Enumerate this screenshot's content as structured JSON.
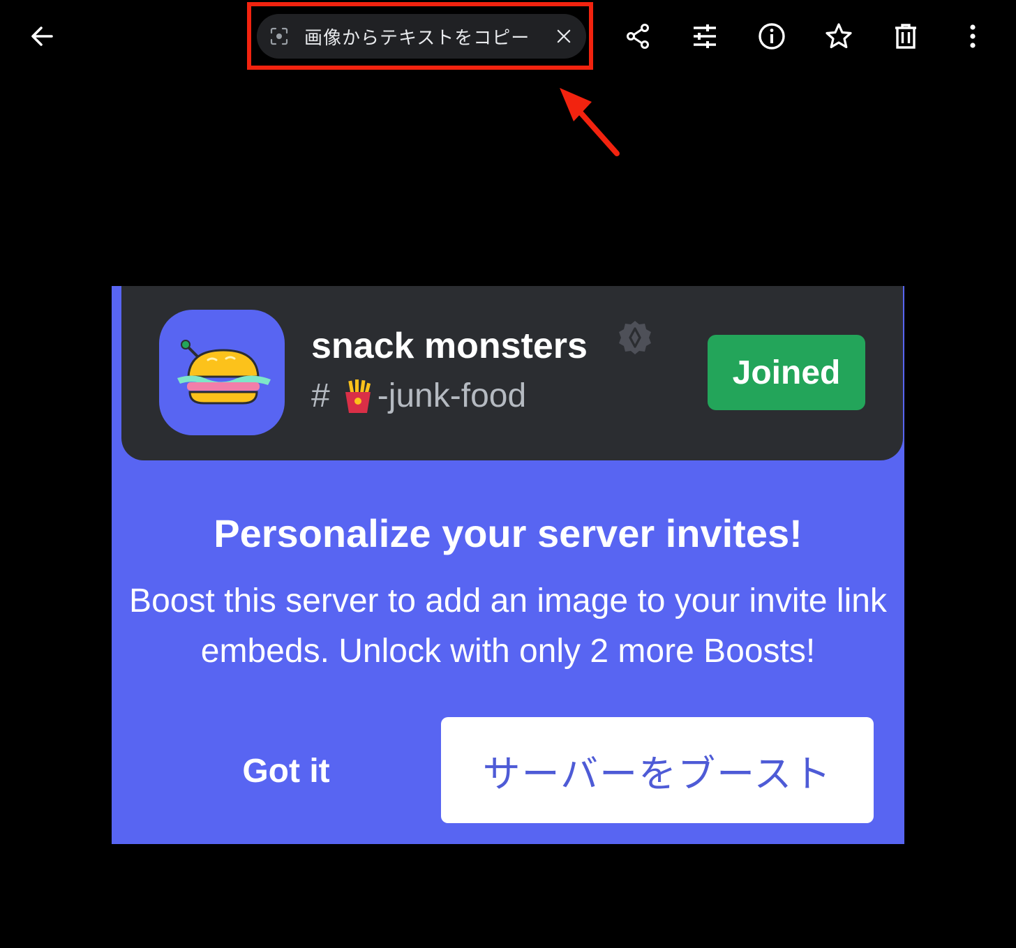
{
  "toolbar": {
    "icons": {
      "back": "arrow-left-icon",
      "share": "share-icon",
      "edit": "tune-sliders-icon",
      "info": "info-icon",
      "favorite": "star-icon",
      "delete": "trash-icon",
      "more": "more-vert-icon"
    },
    "ocr_chip": {
      "label": "画像からテキストをコピー",
      "icon": "lens-scan-icon",
      "close_icon": "close-icon"
    },
    "highlight_color": "#f2230f"
  },
  "photo": {
    "background": "#5865f2",
    "invite": {
      "server_name": "snack monsters",
      "channel_hash": "#",
      "channel_name": "-junk-food",
      "joined_label": "Joined"
    },
    "promo": {
      "title": "Personalize your server invites!",
      "body": "Boost this server to add an image to your invite link embeds. Unlock with only 2 more Boosts!",
      "dismiss_label": "Got it",
      "boost_label": "サーバーをブースト"
    }
  }
}
